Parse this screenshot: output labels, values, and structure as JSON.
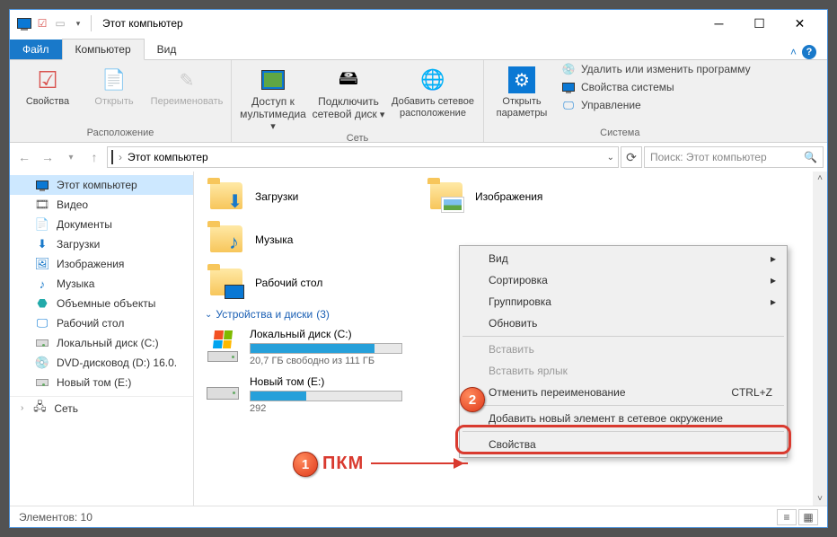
{
  "title": "Этот компьютер",
  "tabs": {
    "file": "Файл",
    "computer": "Компьютер",
    "view": "Вид"
  },
  "ribbon": {
    "location": {
      "label": "Расположение",
      "props": "Свойства",
      "open": "Открыть",
      "rename": "Переименовать"
    },
    "network": {
      "label": "Сеть",
      "media": "Доступ к мультимедиа",
      "mapdrive": "Подключить сетевой диск",
      "addloc": "Добавить сетевое расположение"
    },
    "system": {
      "label": "Система",
      "settings": "Открыть параметры",
      "uninstall": "Удалить или изменить программу",
      "sysprops": "Свойства системы",
      "manage": "Управление"
    }
  },
  "breadcrumb": {
    "root": "Этот компьютер"
  },
  "search_placeholder": "Поиск: Этот компьютер",
  "sidebar": {
    "this_pc": "Этот компьютер",
    "video": "Видео",
    "documents": "Документы",
    "downloads": "Загрузки",
    "pictures": "Изображения",
    "music": "Музыка",
    "objects3d": "Объемные объекты",
    "desktop": "Рабочий стол",
    "drive_c": "Локальный диск (C:)",
    "dvd": "DVD-дисковод (D:) 16.0.",
    "drive_e": "Новый том (E:)",
    "network": "Сеть"
  },
  "folders": {
    "downloads": "Загрузки",
    "pictures": "Изображения",
    "music": "Музыка",
    "desktop": "Рабочий стол"
  },
  "drives": {
    "header": "Устройства и диски",
    "count": "3",
    "c": {
      "name": "Локальный диск (C:)",
      "stat": "20,7 ГБ свободно из 111 ГБ",
      "fill": 82
    },
    "e": {
      "name": "Новый том (E:)",
      "stat": "292",
      "fill": 37
    }
  },
  "context": {
    "view": "Вид",
    "sort": "Сортировка",
    "group": "Группировка",
    "refresh": "Обновить",
    "paste": "Вставить",
    "paste_shortcut": "Вставить ярлык",
    "undo_rename": "Отменить переименование",
    "undo_sc": "CTRL+Z",
    "add_network": "Добавить новый элемент в сетевое окружение",
    "properties": "Свойства"
  },
  "annotation": {
    "pkm": "ПКМ",
    "badge1": "1",
    "badge2": "2"
  },
  "status": {
    "count": "Элементов: 10"
  }
}
